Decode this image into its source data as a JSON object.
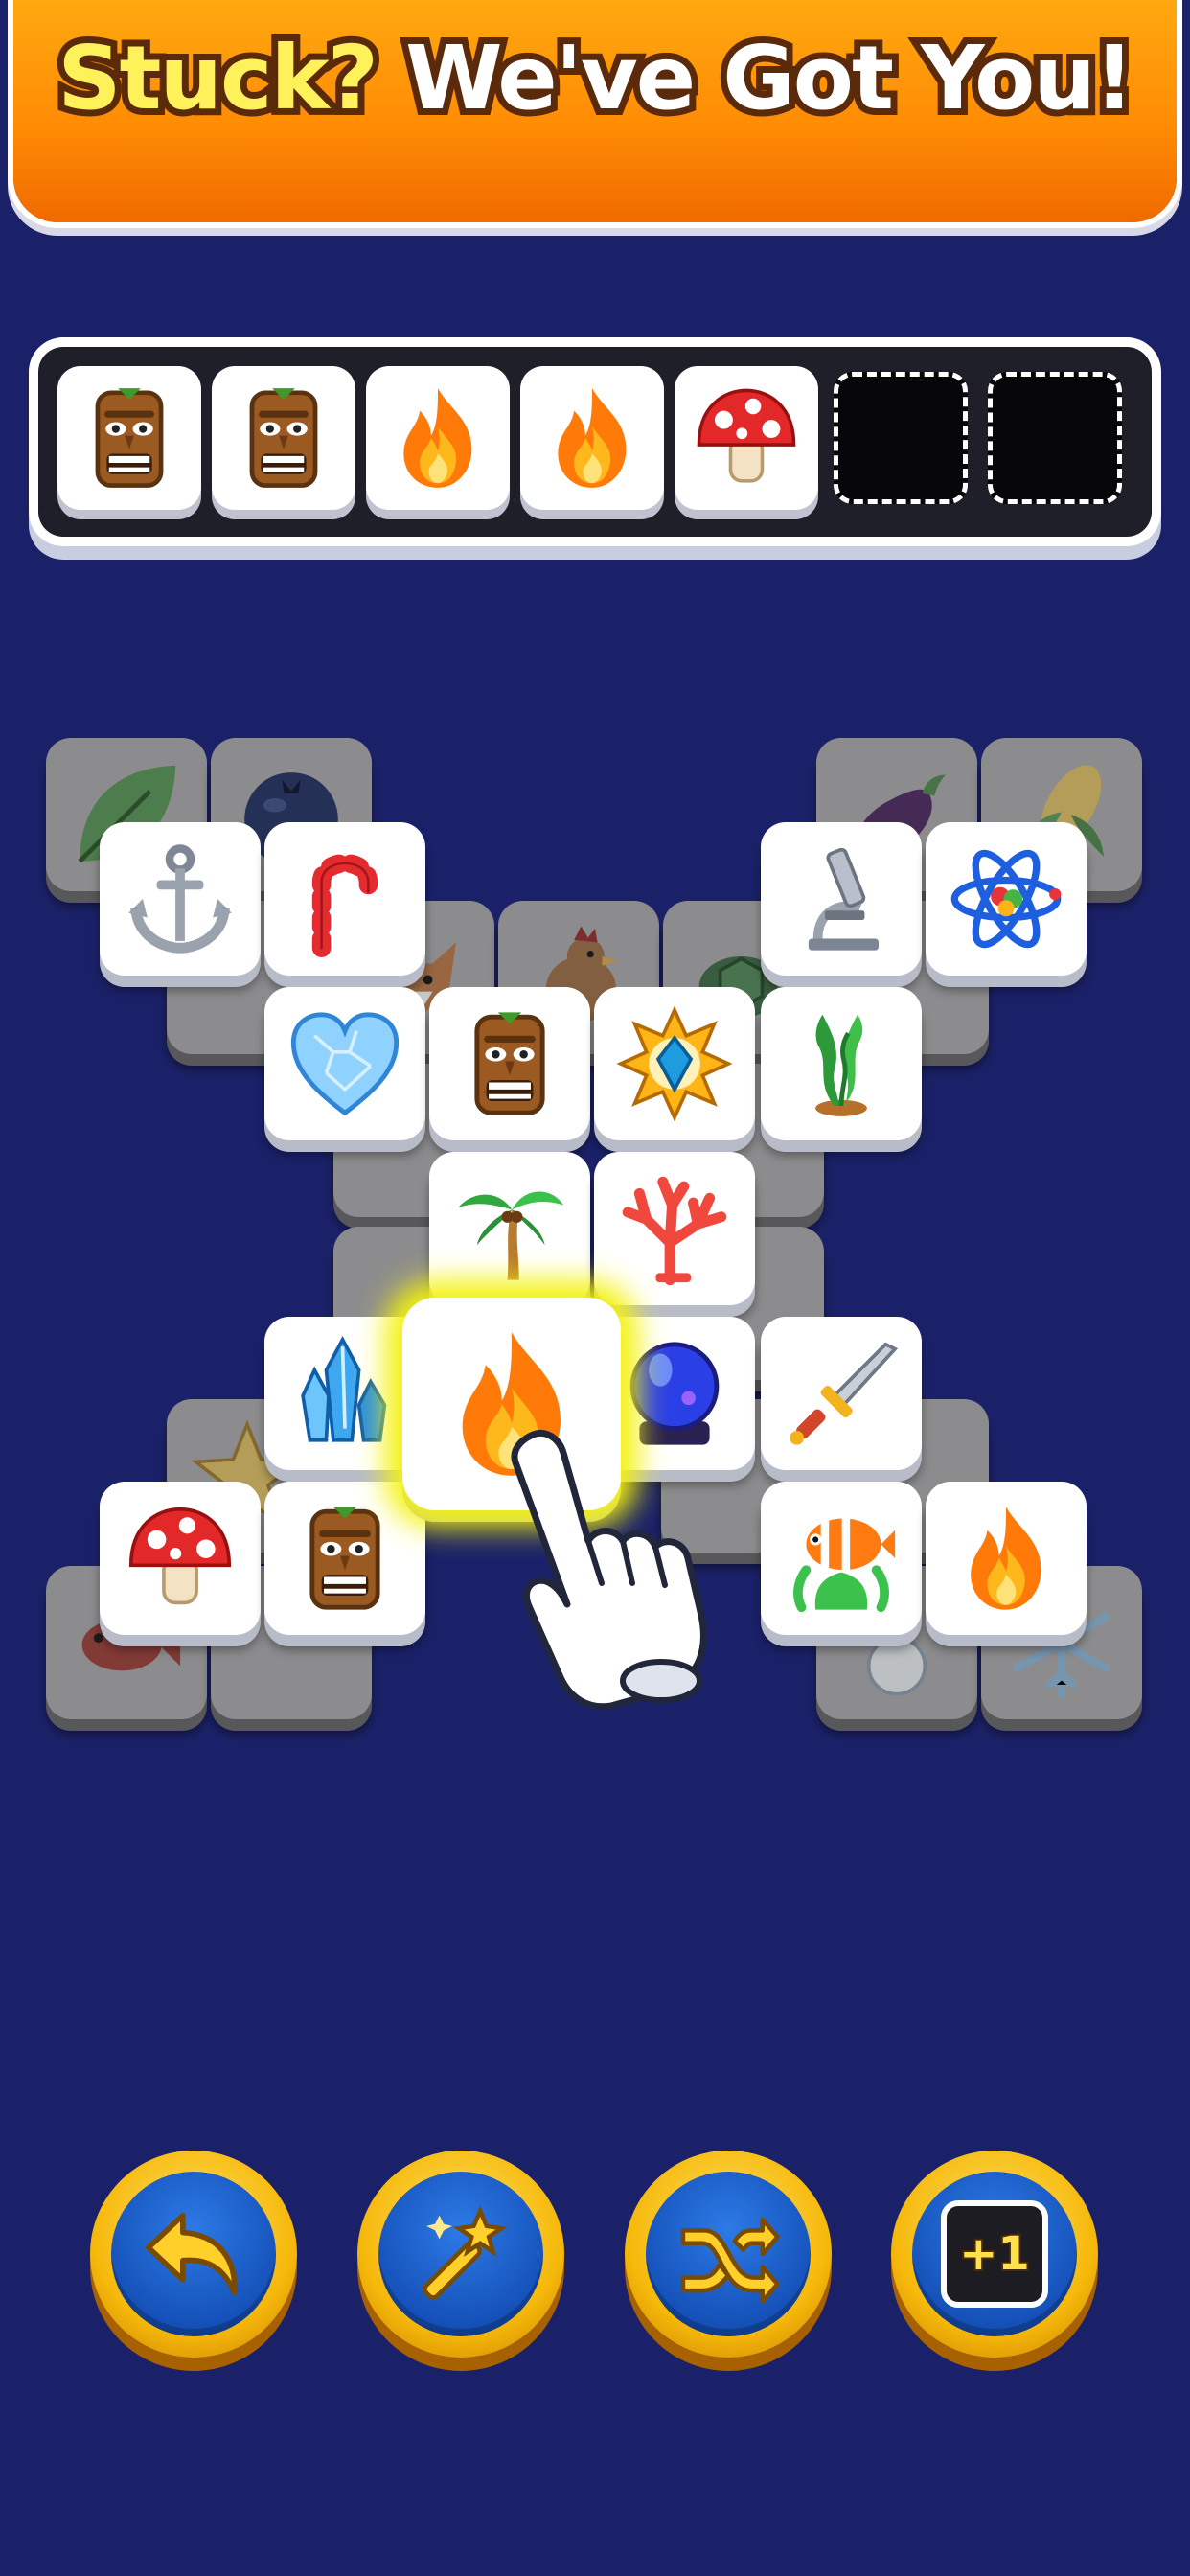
{
  "banner": {
    "title_part1": "Stuck?",
    "title_part2": "We've Got You!"
  },
  "tray": {
    "slots": [
      {
        "icon": "tiki-mask-icon"
      },
      {
        "icon": "tiki-mask-icon"
      },
      {
        "icon": "fire-icon"
      },
      {
        "icon": "fire-icon"
      },
      {
        "icon": "mushroom-icon"
      },
      {
        "icon": "empty"
      },
      {
        "icon": "empty"
      }
    ]
  },
  "board": {
    "highlighted_tile": "fire-icon",
    "top_tiles": [
      "anchor-icon",
      "candy-cane-icon",
      "microscope-icon",
      "atom-icon",
      "ice-heart-icon",
      "tiki-mask-icon",
      "gem-emblem-icon",
      "seaweed-icon",
      "palm-tree-icon",
      "coral-icon",
      "crystal-icon",
      "fire-icon",
      "crystal-ball-icon",
      "dagger-icon",
      "mushroom-icon",
      "tiki-mask-icon",
      "clownfish-icon",
      "fire-icon"
    ],
    "covered_tiles": [
      "leaf-icon",
      "blueberry-icon",
      "eggplant-icon",
      "corn-icon",
      "fox-icon",
      "rooster-icon",
      "turtle-icon",
      "star-icon",
      "fish-icon",
      "snowman-icon",
      "snowflake-icon"
    ]
  },
  "boosters": [
    {
      "name": "undo",
      "icon": "undo-arrow-icon"
    },
    {
      "name": "magic",
      "icon": "magic-wand-icon"
    },
    {
      "name": "shuffle",
      "icon": "shuffle-icon"
    },
    {
      "name": "extra-slot",
      "icon": "plus-one-icon",
      "label": "+1"
    }
  ],
  "colors": {
    "background": "#1b2168",
    "banner": "#ff8d05",
    "booster_ring": "#f6b80a",
    "booster_inner": "#1551b9",
    "highlight": "#f4f20c"
  }
}
